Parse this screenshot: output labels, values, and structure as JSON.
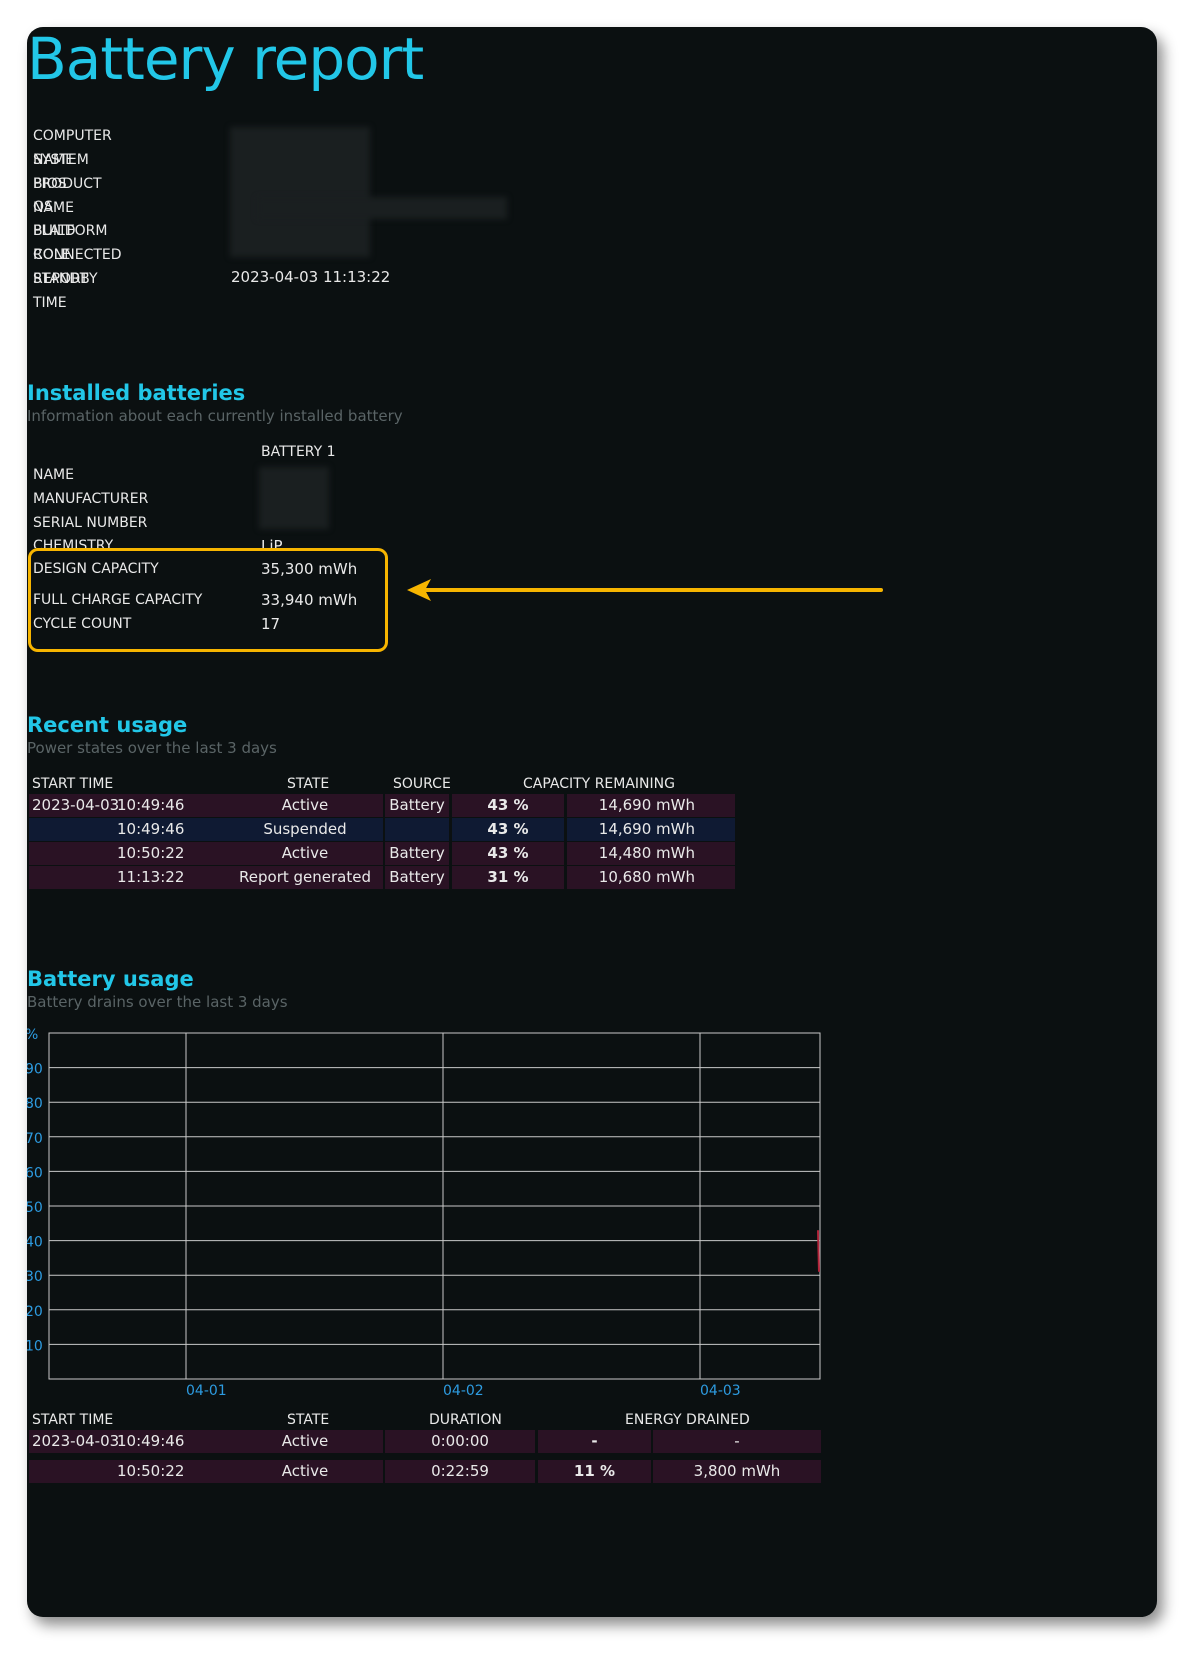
{
  "report": {
    "title": "Battery report"
  },
  "system": {
    "labels": [
      "COMPUTER NAME",
      "SYSTEM PRODUCT NAME",
      "BIOS",
      "OS BUILD",
      "PLATFORM ROLE",
      "CONNECTED STANDBY",
      "REPORT TIME"
    ],
    "report_time": "2023-04-03  11:13:22"
  },
  "installed": {
    "title": "Installed batteries",
    "subtitle": "Information about each currently installed battery",
    "column": "BATTERY 1",
    "labels": [
      "NAME",
      "MANUFACTURER",
      "SERIAL NUMBER",
      "CHEMISTRY",
      "DESIGN CAPACITY",
      "FULL CHARGE CAPACITY",
      "CYCLE COUNT"
    ],
    "chemistry": "LiP",
    "design_capacity": "35,300 mWh",
    "full_charge_capacity": "33,940 mWh",
    "cycle_count": "17"
  },
  "recent": {
    "title": "Recent usage",
    "subtitle": "Power states over the last 3 days",
    "headers": [
      "START TIME",
      "STATE",
      "SOURCE",
      "CAPACITY REMAINING"
    ],
    "rows": [
      {
        "date": "2023-04-03",
        "time": "10:49:46",
        "state": "Active",
        "source": "Battery",
        "pct": "43 %",
        "mwh": "14,690 mWh"
      },
      {
        "date": "",
        "time": "10:49:46",
        "state": "Suspended",
        "source": "",
        "pct": "43 %",
        "mwh": "14,690 mWh"
      },
      {
        "date": "",
        "time": "10:50:22",
        "state": "Active",
        "source": "Battery",
        "pct": "43 %",
        "mwh": "14,480 mWh"
      },
      {
        "date": "",
        "time": "11:13:22",
        "state": "Report generated",
        "source": "Battery",
        "pct": "31 %",
        "mwh": "10,680 mWh"
      }
    ]
  },
  "usage": {
    "title": "Battery usage",
    "subtitle": "Battery drains over the last 3 days",
    "headers": [
      "START TIME",
      "STATE",
      "DURATION",
      "ENERGY DRAINED"
    ],
    "rows": [
      {
        "date": "2023-04-03",
        "time": "10:49:46",
        "state": "Active",
        "duration": "0:00:00",
        "pct": "-",
        "mwh": "-"
      },
      {
        "date": "",
        "time": "10:50:22",
        "state": "Active",
        "duration": "0:22:59",
        "pct": "11 %",
        "mwh": "3,800 mWh"
      }
    ]
  },
  "chart_data": {
    "type": "line",
    "title": "",
    "ylabel": "%",
    "xlabel": "",
    "ylim": [
      0,
      100
    ],
    "y_ticks": [
      "90",
      "80",
      "70",
      "60",
      "50",
      "40",
      "30",
      "20",
      "10"
    ],
    "x_ticks": [
      "04-01",
      "04-02",
      "04-03"
    ],
    "grid": true,
    "series": []
  },
  "colors": {
    "accent": "#22c7e8",
    "highlight": "#f7b500",
    "row_a": "#2a1224",
    "row_b": "#0f1a33",
    "axis": "#2d9be0"
  }
}
